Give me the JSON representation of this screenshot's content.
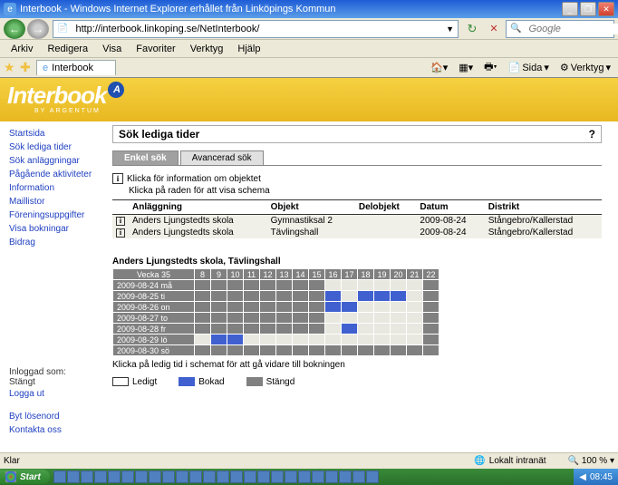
{
  "window": {
    "title": "Interbook - Windows Internet Explorer erhållet från Linköpings Kommun",
    "url": "http://interbook.linkoping.se/NetInterbook/",
    "search_placeholder": "Google"
  },
  "menu": [
    "Arkiv",
    "Redigera",
    "Visa",
    "Favoriter",
    "Verktyg",
    "Hjälp"
  ],
  "tab": {
    "label": "Interbook"
  },
  "ie_tools": {
    "sida": "Sida",
    "verktyg": "Verktyg"
  },
  "brand": {
    "name": "Interbook",
    "by": "BY ARGENTUM"
  },
  "nav": {
    "items": [
      "Startsida",
      "Sök lediga tider",
      "Sök anläggningar",
      "Pågående aktiviteter",
      "Information",
      "Maillistor",
      "Föreningsuppgifter",
      "Visa bokningar",
      "Bidrag"
    ],
    "logged_label": "Inloggad som:",
    "logged_user": "Stängt",
    "logout": "Logga ut",
    "change_pw": "Byt lösenord",
    "contact": "Kontakta oss",
    "footer_brand": "Interbook"
  },
  "page": {
    "title": "Sök lediga tider",
    "help": "?",
    "tabs": {
      "simple": "Enkel sök",
      "advanced": "Avancerad sök"
    },
    "info1": "Klicka för information om objektet",
    "info2": "Klicka på raden för att visa schema",
    "table": {
      "headers": [
        "Anläggning",
        "Objekt",
        "Delobjekt",
        "Datum",
        "Distrikt"
      ],
      "rows": [
        {
          "anl": "Anders Ljungstedts skola",
          "obj": "Gymnastiksal 2",
          "del": "",
          "datum": "2009-08-24",
          "dist": "Stångebro/Kallerstad"
        },
        {
          "anl": "Anders Ljungstedts skola",
          "obj": "Tävlingshall",
          "del": "",
          "datum": "2009-08-24",
          "dist": "Stångebro/Kallerstad"
        }
      ]
    },
    "schedule": {
      "title": "Anders Ljungstedts skola, Tävlingshall",
      "week_label": "Vecka 35",
      "hours": [
        "8",
        "9",
        "10",
        "11",
        "12",
        "13",
        "14",
        "15",
        "16",
        "17",
        "18",
        "19",
        "20",
        "21",
        "22"
      ],
      "days": [
        {
          "label": "2009-08-24 må",
          "cells": [
            "cl",
            "cl",
            "cl",
            "cl",
            "cl",
            "cl",
            "cl",
            "cl",
            "",
            "",
            "",
            "",
            "",
            "",
            "cl"
          ]
        },
        {
          "label": "2009-08-25 ti",
          "cells": [
            "cl",
            "cl",
            "cl",
            "cl",
            "cl",
            "cl",
            "cl",
            "cl",
            "bk",
            "",
            "bk",
            "bk",
            "bk",
            "",
            "cl"
          ]
        },
        {
          "label": "2009-08-26 on",
          "cells": [
            "cl",
            "cl",
            "cl",
            "cl",
            "cl",
            "cl",
            "cl",
            "cl",
            "bk",
            "bk",
            "",
            "",
            "",
            "",
            "cl"
          ]
        },
        {
          "label": "2009-08-27 to",
          "cells": [
            "cl",
            "cl",
            "cl",
            "cl",
            "cl",
            "cl",
            "cl",
            "cl",
            "",
            "",
            "",
            "",
            "",
            "",
            "cl"
          ]
        },
        {
          "label": "2009-08-28 fr",
          "cells": [
            "cl",
            "cl",
            "cl",
            "cl",
            "cl",
            "cl",
            "cl",
            "cl",
            "",
            "bk",
            "",
            "",
            "",
            "",
            "cl"
          ]
        },
        {
          "label": "2009-08-29 lö",
          "cells": [
            "",
            "bk",
            "bk",
            "",
            "",
            "",
            "",
            "",
            "",
            "",
            "",
            "",
            "",
            "",
            "cl"
          ]
        },
        {
          "label": "2009-08-30 sö",
          "cells": [
            "cl",
            "cl",
            "cl",
            "cl",
            "cl",
            "cl",
            "cl",
            "cl",
            "cl",
            "cl",
            "cl",
            "cl",
            "cl",
            "cl",
            "cl"
          ]
        }
      ],
      "note": "Klicka på ledig tid i schemat för att gå vidare till bokningen",
      "legend": {
        "free": "Ledigt",
        "booked": "Bokad",
        "closed": "Stängd"
      }
    }
  },
  "statusbar": {
    "ready": "Klar",
    "zone": "Lokalt intranät",
    "zoom": "100 %"
  },
  "taskbar": {
    "start": "Start",
    "clock": "08:45"
  }
}
